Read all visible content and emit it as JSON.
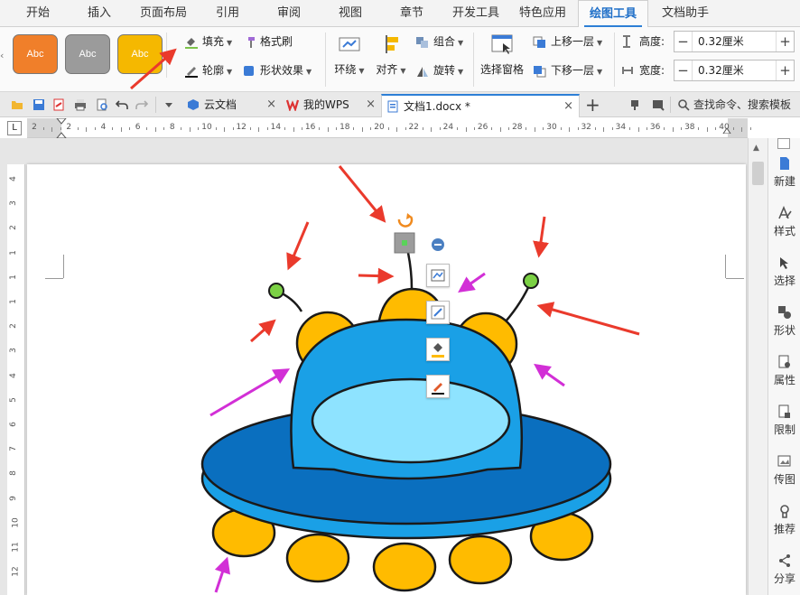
{
  "menu": {
    "tabs": [
      {
        "label": "开始"
      },
      {
        "label": "插入"
      },
      {
        "label": "页面布局"
      },
      {
        "label": "引用"
      },
      {
        "label": "审阅"
      },
      {
        "label": "视图"
      },
      {
        "label": "章节"
      },
      {
        "label": "开发工具"
      },
      {
        "label": "特色应用"
      },
      {
        "label": "绘图工具"
      },
      {
        "label": "文档助手"
      }
    ],
    "active_tab": "绘图工具"
  },
  "ribbon": {
    "styles": [
      {
        "label": "Abc",
        "color": "#f07f2a"
      },
      {
        "label": "Abc",
        "color": "#9b9b9b"
      },
      {
        "label": "Abc",
        "color": "#f5b800"
      }
    ],
    "fill_label": "填充",
    "format_painter_label": "格式刷",
    "outline_label": "轮廓",
    "shape_effect_label": "形状效果",
    "wrap_label": "环绕",
    "align_label": "对齐",
    "group_label": "组合",
    "rotate_label": "旋转",
    "selection_pane_label": "选择窗格",
    "bring_forward_label": "上移一层",
    "send_backward_label": "下移一层",
    "height_label": "高度:",
    "height_value": "0.32厘米",
    "width_label": "宽度:",
    "width_value": "0.32厘米"
  },
  "tabbar": {
    "tabs": [
      {
        "label": "云文档",
        "active": false
      },
      {
        "label": "我的WPS",
        "active": false
      },
      {
        "label": "文档1.docx *",
        "active": true
      }
    ],
    "new_tab_label": "+",
    "search_text": "查找命令、搜索模板"
  },
  "ruler": {
    "h_labels": [
      "2",
      "2",
      "4",
      "6",
      "8",
      "10",
      "12",
      "14",
      "16",
      "18",
      "20",
      "22",
      "24",
      "26",
      "28",
      "30",
      "32",
      "34",
      "36",
      "38",
      "40"
    ],
    "v_labels": [
      "4",
      "3",
      "2",
      "1",
      "1",
      "1",
      "2",
      "3",
      "4",
      "5",
      "6",
      "7",
      "8",
      "9",
      "10",
      "11",
      "12"
    ]
  },
  "sidebar": {
    "items": [
      {
        "label": "新建"
      },
      {
        "label": "样式"
      },
      {
        "label": "选择"
      },
      {
        "label": "形状"
      },
      {
        "label": "属性"
      },
      {
        "label": "限制"
      },
      {
        "label": "传图"
      },
      {
        "label": "推荐"
      },
      {
        "label": "分享"
      }
    ]
  },
  "colors": {
    "accent": "#2d7fd6",
    "ufo_dark_blue": "#0a6fbf",
    "ufo_blue": "#1aa0e6",
    "ufo_light_blue": "#8ee3ff",
    "ufo_orange": "#ffbb00",
    "antenna_green": "#7bd144",
    "arrow_red": "#ea3a2c",
    "arrow_magenta": "#d22fd6"
  }
}
